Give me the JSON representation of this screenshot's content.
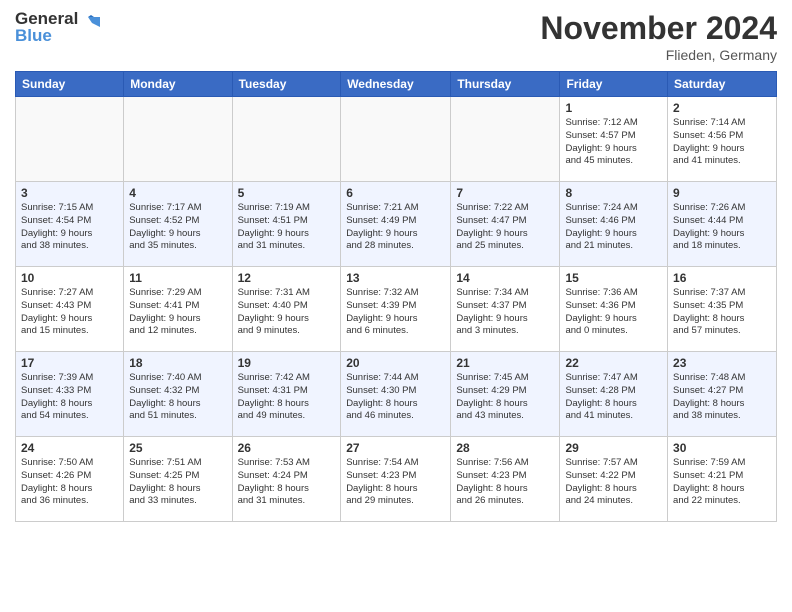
{
  "header": {
    "logo_line1": "General",
    "logo_line2": "Blue",
    "month_title": "November 2024",
    "location": "Flieden, Germany"
  },
  "weekdays": [
    "Sunday",
    "Monday",
    "Tuesday",
    "Wednesday",
    "Thursday",
    "Friday",
    "Saturday"
  ],
  "weeks": [
    [
      {
        "day": "",
        "info": ""
      },
      {
        "day": "",
        "info": ""
      },
      {
        "day": "",
        "info": ""
      },
      {
        "day": "",
        "info": ""
      },
      {
        "day": "",
        "info": ""
      },
      {
        "day": "1",
        "info": "Sunrise: 7:12 AM\nSunset: 4:57 PM\nDaylight: 9 hours\nand 45 minutes."
      },
      {
        "day": "2",
        "info": "Sunrise: 7:14 AM\nSunset: 4:56 PM\nDaylight: 9 hours\nand 41 minutes."
      }
    ],
    [
      {
        "day": "3",
        "info": "Sunrise: 7:15 AM\nSunset: 4:54 PM\nDaylight: 9 hours\nand 38 minutes."
      },
      {
        "day": "4",
        "info": "Sunrise: 7:17 AM\nSunset: 4:52 PM\nDaylight: 9 hours\nand 35 minutes."
      },
      {
        "day": "5",
        "info": "Sunrise: 7:19 AM\nSunset: 4:51 PM\nDaylight: 9 hours\nand 31 minutes."
      },
      {
        "day": "6",
        "info": "Sunrise: 7:21 AM\nSunset: 4:49 PM\nDaylight: 9 hours\nand 28 minutes."
      },
      {
        "day": "7",
        "info": "Sunrise: 7:22 AM\nSunset: 4:47 PM\nDaylight: 9 hours\nand 25 minutes."
      },
      {
        "day": "8",
        "info": "Sunrise: 7:24 AM\nSunset: 4:46 PM\nDaylight: 9 hours\nand 21 minutes."
      },
      {
        "day": "9",
        "info": "Sunrise: 7:26 AM\nSunset: 4:44 PM\nDaylight: 9 hours\nand 18 minutes."
      }
    ],
    [
      {
        "day": "10",
        "info": "Sunrise: 7:27 AM\nSunset: 4:43 PM\nDaylight: 9 hours\nand 15 minutes."
      },
      {
        "day": "11",
        "info": "Sunrise: 7:29 AM\nSunset: 4:41 PM\nDaylight: 9 hours\nand 12 minutes."
      },
      {
        "day": "12",
        "info": "Sunrise: 7:31 AM\nSunset: 4:40 PM\nDaylight: 9 hours\nand 9 minutes."
      },
      {
        "day": "13",
        "info": "Sunrise: 7:32 AM\nSunset: 4:39 PM\nDaylight: 9 hours\nand 6 minutes."
      },
      {
        "day": "14",
        "info": "Sunrise: 7:34 AM\nSunset: 4:37 PM\nDaylight: 9 hours\nand 3 minutes."
      },
      {
        "day": "15",
        "info": "Sunrise: 7:36 AM\nSunset: 4:36 PM\nDaylight: 9 hours\nand 0 minutes."
      },
      {
        "day": "16",
        "info": "Sunrise: 7:37 AM\nSunset: 4:35 PM\nDaylight: 8 hours\nand 57 minutes."
      }
    ],
    [
      {
        "day": "17",
        "info": "Sunrise: 7:39 AM\nSunset: 4:33 PM\nDaylight: 8 hours\nand 54 minutes."
      },
      {
        "day": "18",
        "info": "Sunrise: 7:40 AM\nSunset: 4:32 PM\nDaylight: 8 hours\nand 51 minutes."
      },
      {
        "day": "19",
        "info": "Sunrise: 7:42 AM\nSunset: 4:31 PM\nDaylight: 8 hours\nand 49 minutes."
      },
      {
        "day": "20",
        "info": "Sunrise: 7:44 AM\nSunset: 4:30 PM\nDaylight: 8 hours\nand 46 minutes."
      },
      {
        "day": "21",
        "info": "Sunrise: 7:45 AM\nSunset: 4:29 PM\nDaylight: 8 hours\nand 43 minutes."
      },
      {
        "day": "22",
        "info": "Sunrise: 7:47 AM\nSunset: 4:28 PM\nDaylight: 8 hours\nand 41 minutes."
      },
      {
        "day": "23",
        "info": "Sunrise: 7:48 AM\nSunset: 4:27 PM\nDaylight: 8 hours\nand 38 minutes."
      }
    ],
    [
      {
        "day": "24",
        "info": "Sunrise: 7:50 AM\nSunset: 4:26 PM\nDaylight: 8 hours\nand 36 minutes."
      },
      {
        "day": "25",
        "info": "Sunrise: 7:51 AM\nSunset: 4:25 PM\nDaylight: 8 hours\nand 33 minutes."
      },
      {
        "day": "26",
        "info": "Sunrise: 7:53 AM\nSunset: 4:24 PM\nDaylight: 8 hours\nand 31 minutes."
      },
      {
        "day": "27",
        "info": "Sunrise: 7:54 AM\nSunset: 4:23 PM\nDaylight: 8 hours\nand 29 minutes."
      },
      {
        "day": "28",
        "info": "Sunrise: 7:56 AM\nSunset: 4:23 PM\nDaylight: 8 hours\nand 26 minutes."
      },
      {
        "day": "29",
        "info": "Sunrise: 7:57 AM\nSunset: 4:22 PM\nDaylight: 8 hours\nand 24 minutes."
      },
      {
        "day": "30",
        "info": "Sunrise: 7:59 AM\nSunset: 4:21 PM\nDaylight: 8 hours\nand 22 minutes."
      }
    ]
  ]
}
